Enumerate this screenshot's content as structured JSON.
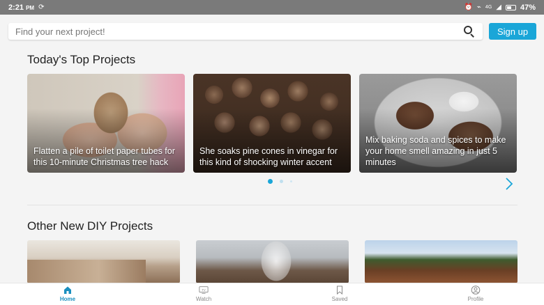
{
  "status_bar": {
    "time": "2:21",
    "ampm": "PM",
    "network": "4G",
    "battery": "47%"
  },
  "search": {
    "placeholder": "Find your next project!"
  },
  "header": {
    "signup_label": "Sign up"
  },
  "top_projects": {
    "title": "Today's Top Projects",
    "cards": [
      {
        "caption": "Flatten a pile of toilet paper tubes for this 10-minute Christmas tree hack"
      },
      {
        "caption": "She soaks pine cones in vinegar for this kind of shocking winter accent"
      },
      {
        "caption": "Mix baking soda and spices to make your home smell amazing in just 5 minutes"
      }
    ],
    "pager": {
      "current": 1,
      "total": 3
    }
  },
  "other_projects": {
    "title": "Other New DIY Projects"
  },
  "bottom_nav": {
    "items": [
      {
        "label": "Home",
        "icon": "home-icon",
        "active": true
      },
      {
        "label": "Watch",
        "icon": "tv-icon",
        "active": false
      },
      {
        "label": "Saved",
        "icon": "bookmark-icon",
        "active": false
      },
      {
        "label": "Profile",
        "icon": "profile-icon",
        "active": false
      }
    ]
  },
  "colors": {
    "accent": "#1aa6d8",
    "status_bar": "#7a7a7a",
    "background": "#f4f4f4"
  }
}
